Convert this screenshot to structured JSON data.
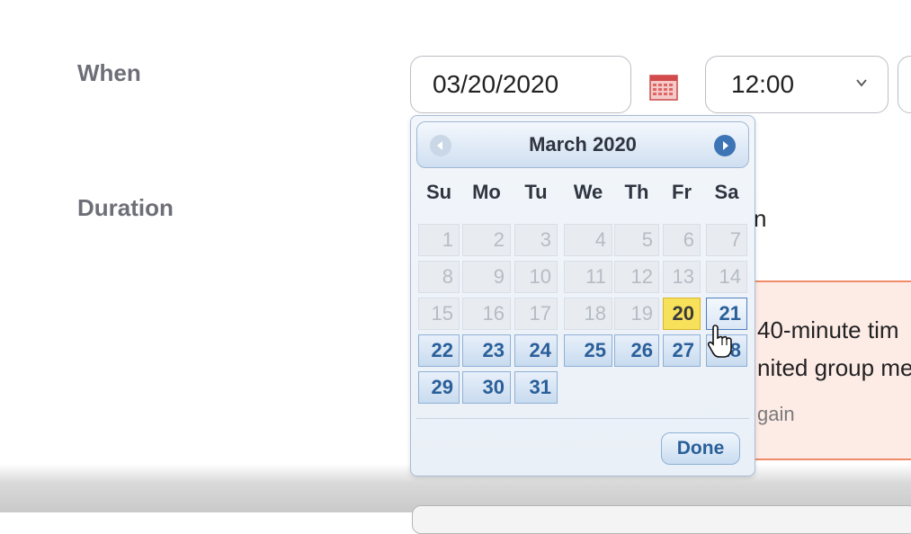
{
  "form": {
    "when_label": "When",
    "duration_label": "Duration",
    "date_value": "03/20/2020",
    "time_value": "12:00",
    "duration_tail_text": "n"
  },
  "notice": {
    "line1": "40-minute tim",
    "line2": "nited group me",
    "line3": "gain"
  },
  "datepicker": {
    "month_title": "March 2020",
    "weekdays": [
      "Su",
      "Mo",
      "Tu",
      "We",
      "Th",
      "Fr",
      "Sa"
    ],
    "days": [
      "1",
      "2",
      "3",
      "4",
      "5",
      "6",
      "7",
      "8",
      "9",
      "10",
      "11",
      "12",
      "13",
      "14",
      "15",
      "16",
      "17",
      "18",
      "19",
      "20",
      "21",
      "22",
      "23",
      "24",
      "25",
      "26",
      "27",
      "28",
      "29",
      "30",
      "31"
    ],
    "selected_day": "20",
    "hovered_day": "21",
    "done_label": "Done"
  },
  "colors": {
    "accent": "#3d74b5",
    "highlight": "#f8e15a",
    "notice_bg": "#fdebe6",
    "notice_border": "#ef8c6a"
  },
  "icons": {
    "calendar": "calendar-icon",
    "chevron": "chevron-down-icon",
    "prev": "prev-month-icon",
    "next": "next-month-icon",
    "cursor": "hand-cursor-icon"
  }
}
